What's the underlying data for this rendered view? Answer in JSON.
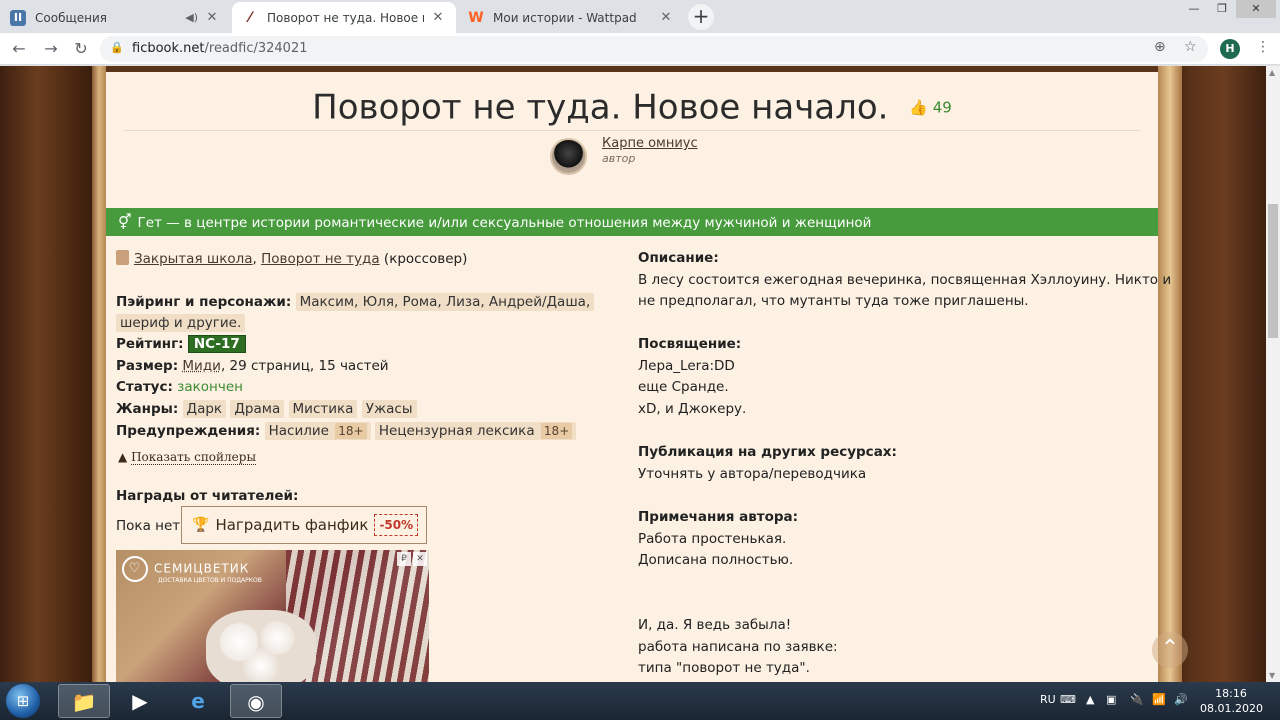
{
  "browser": {
    "tabs": [
      {
        "title": "Сообщения",
        "icon": "vk-icon",
        "icon_text": "II",
        "color": "#4a76a8"
      },
      {
        "title": "Поворот не туда. Новое начало",
        "icon": "ficbook-quill-icon",
        "icon_text": "⁄",
        "color": "#7b2d26"
      },
      {
        "title": "Мои истории - Wattpad",
        "icon": "wattpad-icon",
        "icon_text": "W",
        "color": "#ff6122"
      }
    ],
    "new_tab_label": "+",
    "url_host": "ficbook.net",
    "url_path": "/readfic/324021",
    "profile_initial": "H"
  },
  "fic": {
    "title": "Поворот не туда. Новое начало.",
    "likes": "49",
    "author_name": "Карпе омниус",
    "author_role": "автор",
    "genre_bar": "Гет — в центре истории романтические и/или сексуальные отношения между мужчиной и женщиной",
    "fandom_1": "Закрытая школа",
    "fandom_sep": ",",
    "fandom_2": "Поворот не туда",
    "fandom_note": "(кроссовер)",
    "pairing_label": "Пэйринг и персонажи:",
    "pairing_line1": "Максим, Юля, Рома, Лиза, Андрей/Даша,",
    "pairing_line2": "шериф и другие.",
    "rating_label": "Рейтинг:",
    "rating": "NC-17",
    "size_label": "Размер:",
    "size_link": "Миди",
    "size_rest": ", 29 страниц, 15 частей",
    "status_label": "Статус:",
    "status": "закончен",
    "genres_label": "Жанры:",
    "genres": [
      "Дарк",
      "Драма",
      "Мистика",
      "Ужасы"
    ],
    "warnings_label": "Предупреждения:",
    "warnings": [
      {
        "name": "Насилие",
        "age": "18+"
      },
      {
        "name": "Нецензурная лексика",
        "age": "18+"
      }
    ],
    "spoilers": "Показать спойлеры",
    "awards_label": "Награды от читателей:",
    "awards_none": "Пока нет",
    "award_button": "Наградить фанфик",
    "award_discount": "-50%",
    "ad_brand": "СЕМИЦВЕТИК",
    "ad_sub": "ДОСТАВКА ЦВЕТОВ И ПОДАРКОВ",
    "ad_badge": "₽",
    "ad_close": "✕",
    "description_label": "Описание:",
    "description_line1": "В лесу состоится ежегодная вечеринка, посвященная Хэллоуину. Никто и",
    "description_line2": "не предполагал, что мутанты туда тоже приглашены.",
    "dedication_label": "Посвящение:",
    "dedication": [
      "Лера_Lera:DD",
      "еще Сранде.",
      "xD, и Джокеру."
    ],
    "other_label": "Публикация на других ресурсах:",
    "other": "Уточнять у автора/переводчика",
    "notes_label": "Примечания автора:",
    "notes": [
      "Работа простенькая.",
      "Дописана полностью."
    ],
    "notes2": [
      "И, да. Я ведь забыла!",
      "работа написана по заявке:",
      "типа \"поворот не туда\"."
    ]
  },
  "taskbar": {
    "lang": "RU",
    "time": "18:16",
    "date": "08.01.2020"
  },
  "colors": {
    "genre_green": "#479b3d",
    "paper": "#fcf1e3",
    "rating_green": "#2e6e22"
  }
}
